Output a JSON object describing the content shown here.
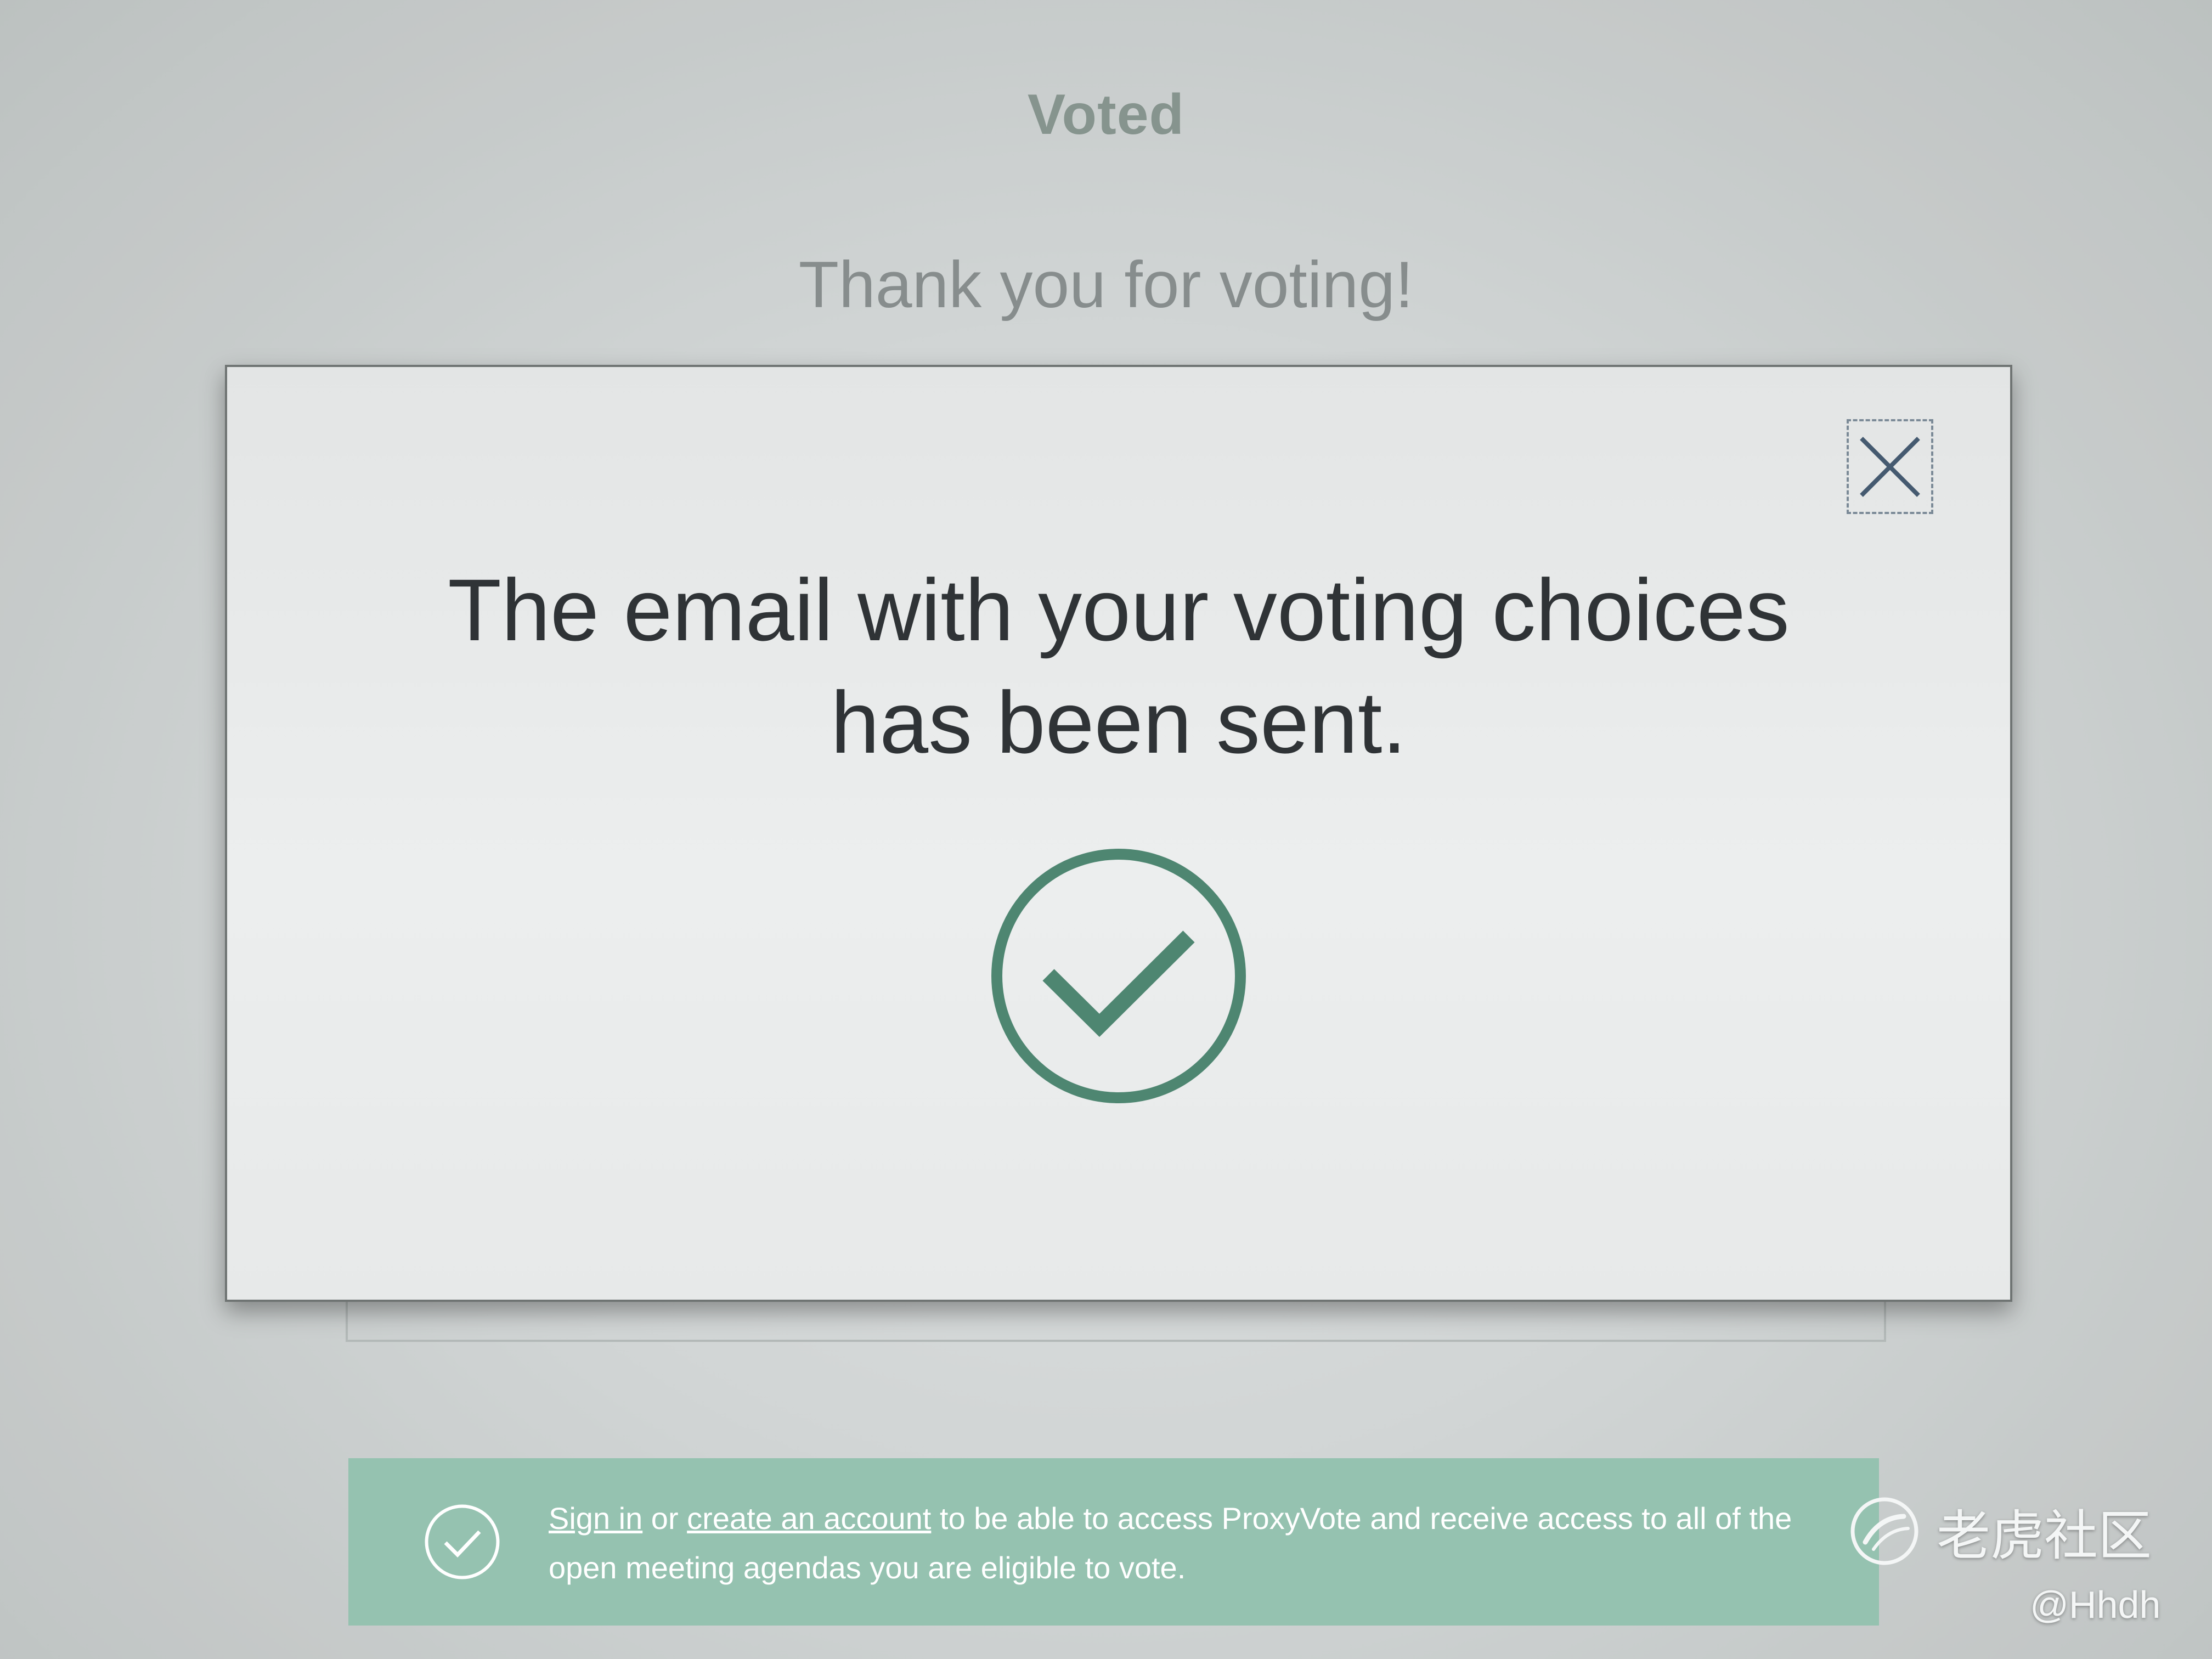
{
  "page": {
    "heading": "Voted",
    "subheading": "Thank you for voting!"
  },
  "modal": {
    "close_icon": "close-icon",
    "message_line1": "The email with your voting choices",
    "message_line2": "has been sent.",
    "status_icon": "check-circle-icon",
    "accent_color": "#4e8671"
  },
  "banner": {
    "icon": "check-circle-icon",
    "sign_in_link": "Sign in",
    "or_text": " or ",
    "create_account_link": "create an account",
    "tail_text": " to be able to access ProxyVote and receive access to all of the open meeting agendas you are eligible to vote.",
    "background_color": "#95c2b0"
  },
  "watermark": {
    "brand": "老虎社区",
    "handle": "@Hhdh"
  }
}
